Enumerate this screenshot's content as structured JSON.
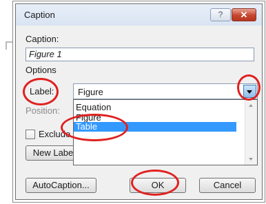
{
  "dialog": {
    "title": "Caption",
    "help_glyph": "?",
    "close_glyph": "✕"
  },
  "caption": {
    "label": "Caption:",
    "value": "Figure 1"
  },
  "options": {
    "heading": "Options",
    "label_label": "Label:",
    "label_value": "Figure",
    "position_label": "Position:",
    "exclude_label": "Exclude l",
    "new_label_button": "New Labe"
  },
  "dropdown": {
    "items": [
      "Equation",
      "Figure",
      "Table"
    ],
    "selected": "Table"
  },
  "buttons": {
    "autocaption": "AutoCaption...",
    "ok": "OK",
    "cancel": "Cancel"
  },
  "colors": {
    "highlight": "#e0201f",
    "selection": "#3399ff",
    "close_button": "#c5452d"
  },
  "icons": {
    "help": "question-mark",
    "close": "x",
    "dropdown": "triangle-down",
    "scroll_up": "triangle-up",
    "scroll_down": "triangle-down"
  }
}
